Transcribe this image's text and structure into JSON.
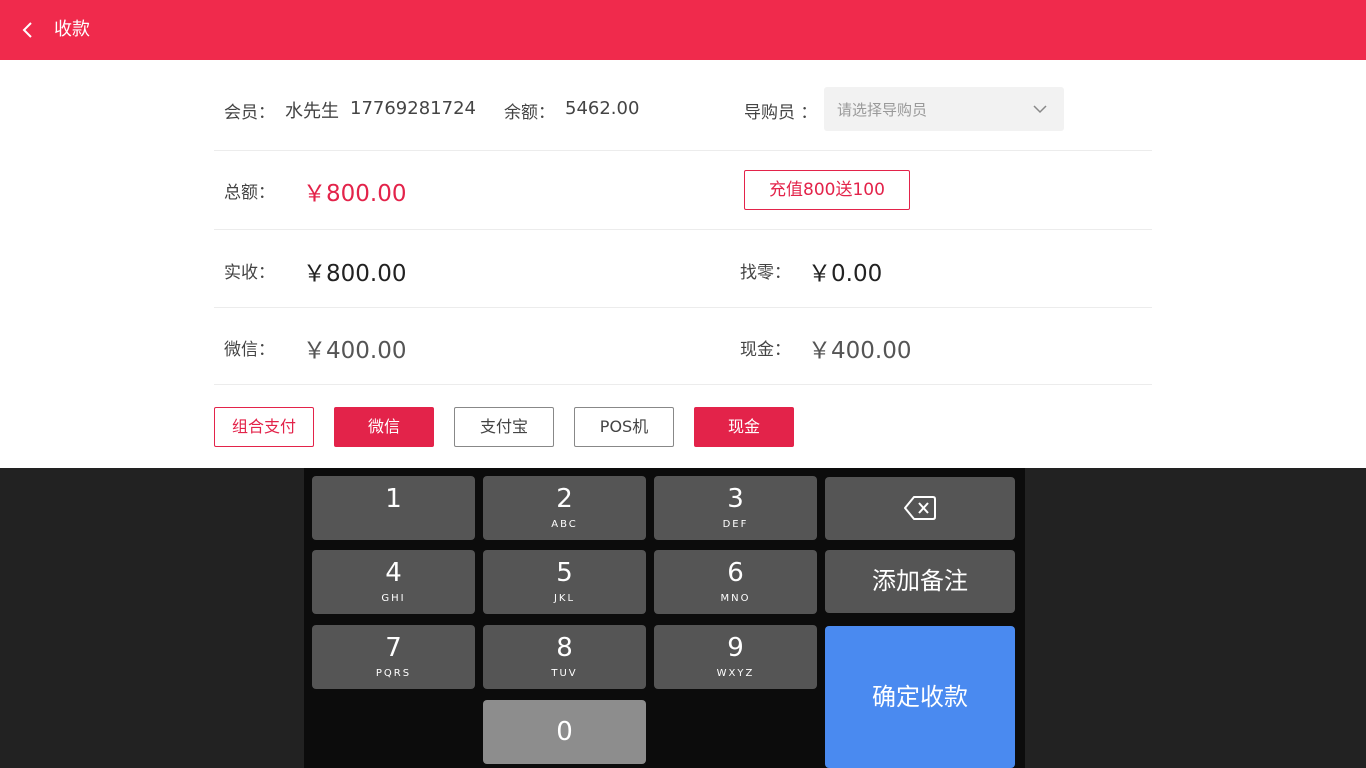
{
  "header": {
    "title": "收款",
    "back_icon": "chevron-left-icon"
  },
  "member": {
    "label": "会员：",
    "name": "水先生",
    "phone": "17769281724",
    "balance_label": "余额：",
    "balance": "5462.00"
  },
  "guide": {
    "label": "导购员 ：",
    "placeholder": "请选择导购员",
    "arrow_icon": "chevron-down-icon"
  },
  "total": {
    "label": "总额：",
    "value": "￥800.00",
    "promo_button": "充值800送100"
  },
  "received": {
    "label": "实收：",
    "value": "￥800.00",
    "change_label": "找零：",
    "change_value": "￥0.00"
  },
  "split": {
    "wechat_label": "微信：",
    "wechat_value": "￥400.00",
    "cash_label": "现金：",
    "cash_value": "￥400.00"
  },
  "payment_methods": [
    {
      "label": "组合支付",
      "state": "selected-outline"
    },
    {
      "label": "微信",
      "state": "active"
    },
    {
      "label": "支付宝",
      "state": "inactive"
    },
    {
      "label": "POS机",
      "state": "inactive"
    },
    {
      "label": "现金",
      "state": "active"
    }
  ],
  "keypad": {
    "keys": [
      {
        "num": "1",
        "sub": ""
      },
      {
        "num": "2",
        "sub": "ABC"
      },
      {
        "num": "3",
        "sub": "DEF"
      },
      {
        "num": "4",
        "sub": "GHI"
      },
      {
        "num": "5",
        "sub": "JKL"
      },
      {
        "num": "6",
        "sub": "MNO"
      },
      {
        "num": "7",
        "sub": "PQRS"
      },
      {
        "num": "8",
        "sub": "TUV"
      },
      {
        "num": "9",
        "sub": "WXYZ"
      },
      {
        "num": "0",
        "sub": ""
      }
    ],
    "backspace_icon": "backspace-icon",
    "add_note": "添加备注",
    "confirm": "确定收款"
  },
  "colors": {
    "brand_red": "#f02a4c",
    "accent_red": "#e3234a",
    "confirm_blue": "#4a8af0",
    "key_gray": "#555555",
    "zero_key_gray": "#8d8d8d"
  }
}
